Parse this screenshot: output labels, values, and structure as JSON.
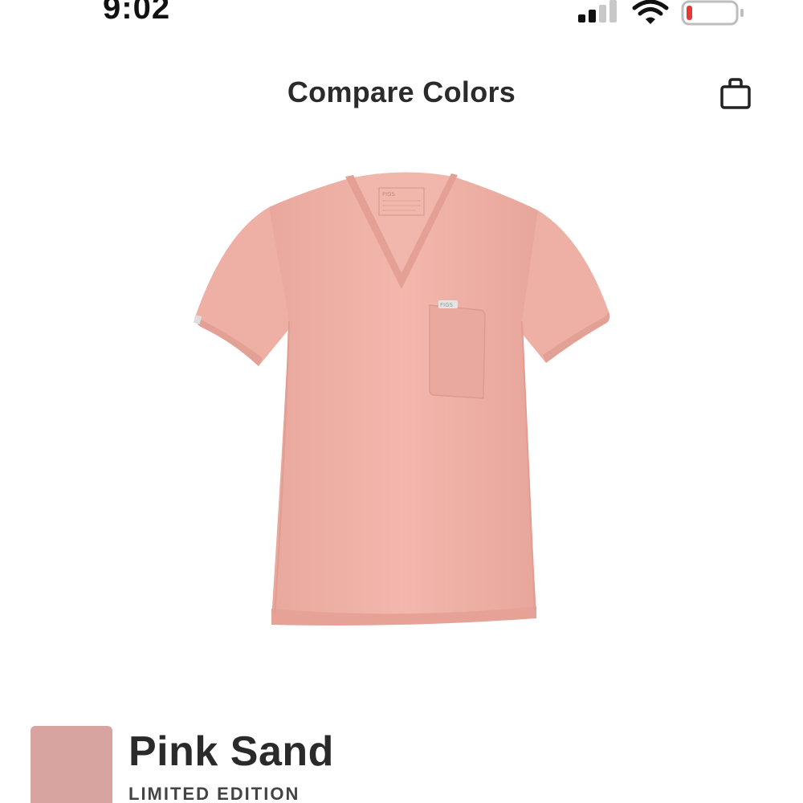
{
  "status_bar": {
    "time": "9:02",
    "signal_icon": "cellular-signal-icon",
    "wifi_icon": "wifi-icon",
    "battery_icon": "battery-low-icon",
    "battery_level": 0.12,
    "battery_color": "#e53935"
  },
  "header": {
    "title": "Compare Colors",
    "bag_icon": "shopping-bag-icon"
  },
  "product": {
    "color_hex": "#efb0a6",
    "pocket_label": "FIGS",
    "neck_label": "FIGS"
  },
  "color_info": {
    "swatch_color": "#d8a4a0",
    "name": "Pink Sand",
    "tag": "LIMITED EDITION"
  }
}
